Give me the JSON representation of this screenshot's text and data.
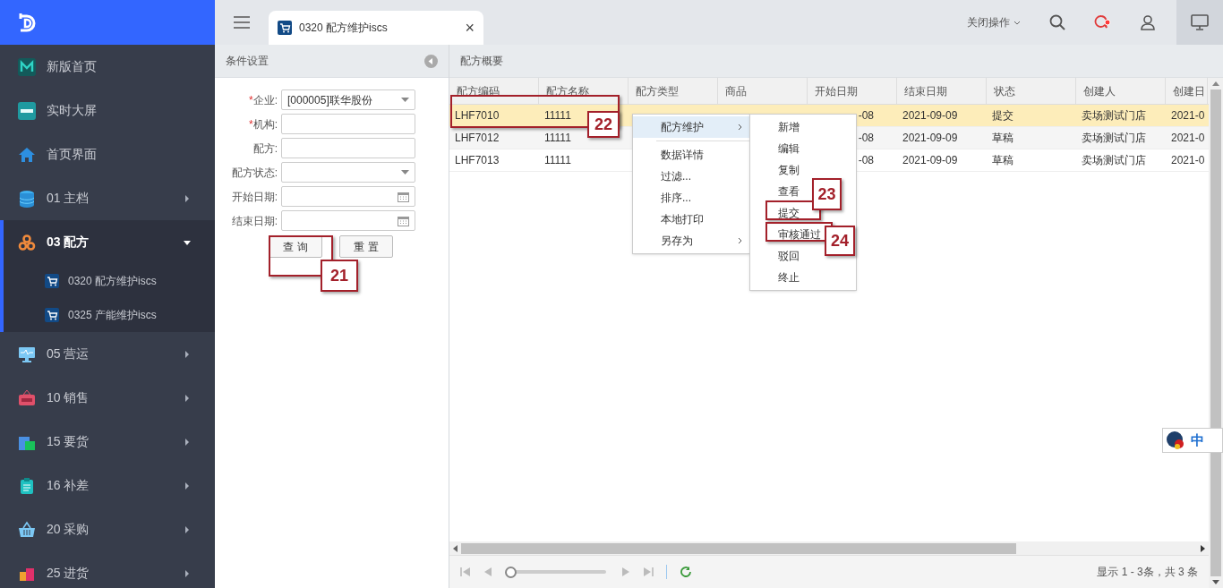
{
  "sidebar": {
    "items": [
      {
        "label": "新版首页",
        "selected": false
      },
      {
        "label": "实时大屏",
        "selected": false
      },
      {
        "label": "首页界面",
        "selected": false
      },
      {
        "label": "01 主档",
        "selected": false,
        "expanded": false
      },
      {
        "label": "03 配方",
        "selected": true,
        "expanded": true,
        "children": [
          {
            "label": "0320 配方维护iscs"
          },
          {
            "label": "0325 产能维护iscs"
          }
        ]
      },
      {
        "label": "05 营运",
        "selected": false,
        "expanded": false
      },
      {
        "label": "10 销售",
        "selected": false,
        "expanded": false
      },
      {
        "label": "15 要货",
        "selected": false,
        "expanded": false
      },
      {
        "label": "16 补差",
        "selected": false,
        "expanded": false
      },
      {
        "label": "20 采购",
        "selected": false,
        "expanded": false
      },
      {
        "label": "25 进货",
        "selected": false,
        "expanded": false
      }
    ]
  },
  "tabs": [
    {
      "label": "0320 配方维护iscs",
      "close": "×",
      "selected": true
    }
  ],
  "toolbar": {
    "close_ops": "关闭操作"
  },
  "filter_panel": {
    "title": "条件设置",
    "fields": [
      {
        "required_mark": "*",
        "label": "企业:",
        "kind": "select",
        "value": "[000005]联华股份"
      },
      {
        "required_mark": "*",
        "label": "机构:",
        "kind": "text"
      },
      {
        "label": "配方:",
        "kind": "text"
      },
      {
        "label": "配方状态:",
        "kind": "select"
      },
      {
        "label": "开始日期:",
        "kind": "date"
      },
      {
        "label": "结束日期:",
        "kind": "date"
      }
    ],
    "buttons": [
      "查 询",
      "重 置"
    ]
  },
  "grid": {
    "title": "配方概要",
    "columns": [
      "配方编码",
      "配方名称",
      "配方类型",
      "商品",
      "开始日期",
      "结束日期",
      "状态",
      "创建人",
      "创建日"
    ],
    "rows": [
      {
        "selected": true,
        "cells": [
          "LHF7010",
          "11111",
          "",
          "",
          "-08",
          "2021-09-09",
          "提交",
          "卖场测试门店",
          "2021-0"
        ]
      },
      {
        "selected": false,
        "cells": [
          "LHF7012",
          "11111",
          "",
          "",
          "-08",
          "2021-09-09",
          "草稿",
          "卖场测试门店",
          "2021-0"
        ]
      },
      {
        "selected": false,
        "cells": [
          "LHF7013",
          "11111",
          "",
          "",
          "-08",
          "2021-09-09",
          "草稿",
          "卖场测试门店",
          "2021-0"
        ]
      }
    ],
    "pager": {
      "level": 0,
      "summary": "显示 1 - 3条，共 3 条"
    }
  },
  "context_menu": {
    "items": [
      {
        "label": "配方维护",
        "kind": "submenu",
        "selected": true
      },
      {
        "kind": "separator"
      },
      {
        "label": "数据详情",
        "kind": "item",
        "selected": false
      },
      {
        "label": "过滤...",
        "kind": "item",
        "selected": false
      },
      {
        "label": "排序...",
        "kind": "item",
        "selected": false
      },
      {
        "label": "本地打印",
        "kind": "item",
        "selected": false
      },
      {
        "label": "另存为",
        "kind": "submenu",
        "selected": false
      }
    ],
    "submenu": [
      "新增",
      "编辑",
      "复制",
      "查看",
      "提交",
      "审核通过",
      "驳回",
      "终止"
    ]
  },
  "callouts": [
    {
      "number": "21"
    },
    {
      "number": "22"
    },
    {
      "number": "23"
    },
    {
      "number": "24"
    }
  ],
  "ime": {
    "label": "中"
  }
}
